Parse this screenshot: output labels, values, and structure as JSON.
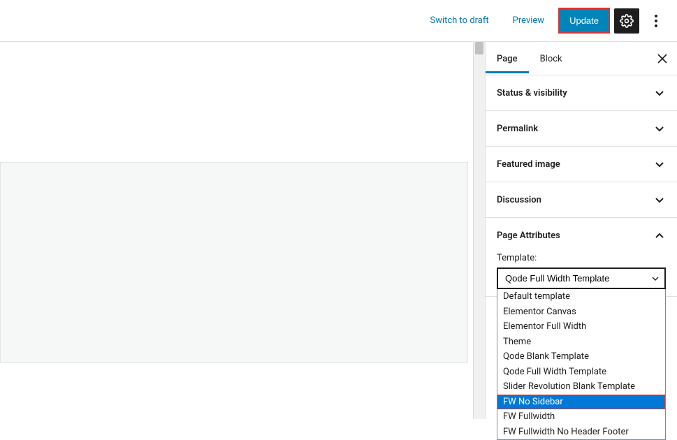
{
  "toolbar": {
    "switch_draft": "Switch to draft",
    "preview": "Preview",
    "update": "Update"
  },
  "tabs": {
    "page": "Page",
    "block": "Block"
  },
  "panels": {
    "status": "Status & visibility",
    "permalink": "Permalink",
    "featured_image": "Featured image",
    "discussion": "Discussion",
    "page_attributes": "Page Attributes"
  },
  "template": {
    "label": "Template:",
    "selected": "Qode Full Width Template",
    "options": [
      "Default template",
      "Elementor Canvas",
      "Elementor Full Width",
      "Theme",
      "Qode Blank Template",
      "Qode Full Width Template",
      "Slider Revolution Blank Template",
      "FW No Sidebar",
      "FW Fullwidth",
      "FW Fullwidth No Header Footer"
    ],
    "highlighted": "FW No Sidebar"
  }
}
